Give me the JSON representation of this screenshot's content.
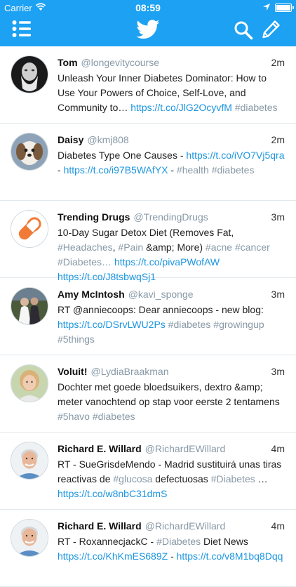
{
  "status": {
    "carrier": "Carrier",
    "time": "08:59"
  },
  "colors": {
    "brand": "#1da1f2",
    "link": "#1b95e0",
    "hashtag": "#8899a6"
  },
  "nav": {
    "menu_icon": "list-icon",
    "logo_icon": "twitter-bird-icon",
    "search_icon": "search-icon",
    "compose_icon": "compose-icon"
  },
  "tweets": [
    {
      "name": "Tom",
      "handle": "@longevitycourse",
      "time": "2m",
      "avatar": "photo-sculpture",
      "segments": [
        {
          "type": "text",
          "value": "Unleash Your Inner Diabetes Dominator: How to Use Your Powers of Choice, Self-Love, and Community to… "
        },
        {
          "type": "link",
          "value": "https://t.co/JlG2OcyvfM"
        },
        {
          "type": "text",
          "value": " "
        },
        {
          "type": "tag",
          "value": "#diabetes"
        }
      ]
    },
    {
      "name": "Daisy",
      "handle": "@kmj808",
      "time": "2m",
      "avatar": "photo-dog",
      "segments": [
        {
          "type": "text",
          "value": "Diabetes Type One Causes - "
        },
        {
          "type": "link",
          "value": "https://t.co/iVO7Vj5qra"
        },
        {
          "type": "text",
          "value": " - "
        },
        {
          "type": "link",
          "value": "https://t.co/i97B5WAfYX"
        },
        {
          "type": "text",
          "value": " - "
        },
        {
          "type": "tag",
          "value": "#health"
        },
        {
          "type": "text",
          "value": " "
        },
        {
          "type": "tag",
          "value": "#diabetes"
        }
      ]
    },
    {
      "name": "Trending Drugs",
      "handle": "@TrendingDrugs",
      "time": "3m",
      "avatar": "logo-pill",
      "segments": [
        {
          "type": "text",
          "value": "10-Day Sugar Detox Diet (Removes Fat, "
        },
        {
          "type": "tag",
          "value": "#Headaches"
        },
        {
          "type": "text",
          "value": ", "
        },
        {
          "type": "tag",
          "value": "#Pain"
        },
        {
          "type": "text",
          "value": " &amp; More) "
        },
        {
          "type": "tag",
          "value": "#acne"
        },
        {
          "type": "text",
          "value": " "
        },
        {
          "type": "tag",
          "value": "#cancer"
        },
        {
          "type": "text",
          "value": " "
        },
        {
          "type": "tag",
          "value": "#Diabetes…"
        },
        {
          "type": "text",
          "value": " "
        },
        {
          "type": "link",
          "value": "https://t.co/pivaPWofAW"
        },
        {
          "type": "text",
          "value": " "
        },
        {
          "type": "link",
          "value": "https://t.co/J8tsbwqSj1"
        }
      ]
    },
    {
      "name": "Amy McIntosh",
      "handle": "@kavi_sponge",
      "time": "3m",
      "avatar": "photo-wedding",
      "segments": [
        {
          "type": "text",
          "value": "RT @anniecoops: Dear anniecoops - new blog: "
        },
        {
          "type": "link",
          "value": "https://t.co/DSrvLWU2Ps"
        },
        {
          "type": "text",
          "value": " "
        },
        {
          "type": "tag",
          "value": "#diabetes"
        },
        {
          "type": "text",
          "value": " "
        },
        {
          "type": "tag",
          "value": "#growingup"
        },
        {
          "type": "text",
          "value": " "
        },
        {
          "type": "tag",
          "value": "#5things"
        }
      ]
    },
    {
      "name": "Voluit!",
      "handle": "@LydiaBraakman",
      "time": "3m",
      "avatar": "photo-woman",
      "segments": [
        {
          "type": "text",
          "value": "Dochter met goede bloedsuikers, dextro &amp; meter vanochtend op stap voor eerste 2 tentamens "
        },
        {
          "type": "tag",
          "value": "#5havo"
        },
        {
          "type": "text",
          "value": " "
        },
        {
          "type": "tag",
          "value": "#diabetes"
        }
      ]
    },
    {
      "name": "Richard E. Willard",
      "handle": "@RichardEWillard",
      "time": "4m",
      "avatar": "photo-man",
      "segments": [
        {
          "type": "text",
          "value": "RT - SueGrisdeMendo - Madrid sustituirá unas tiras reactivas de "
        },
        {
          "type": "tag",
          "value": "#glucosa"
        },
        {
          "type": "text",
          "value": " defectuosas "
        },
        {
          "type": "tag",
          "value": "#Diabetes"
        },
        {
          "type": "text",
          "value": " … "
        },
        {
          "type": "link",
          "value": "https://t.co/w8nbC31dmS"
        }
      ]
    },
    {
      "name": "Richard E. Willard",
      "handle": "@RichardEWillard",
      "time": "4m",
      "avatar": "photo-man",
      "segments": [
        {
          "type": "text",
          "value": "RT - RoxannecjackC - "
        },
        {
          "type": "tag",
          "value": "#Diabetes"
        },
        {
          "type": "text",
          "value": " Diet  News "
        },
        {
          "type": "link",
          "value": "https://t.co/KhKmES689Z"
        },
        {
          "type": "text",
          "value": " - "
        },
        {
          "type": "link",
          "value": "https://t.co/v8M1bq8Dqq"
        }
      ]
    }
  ]
}
